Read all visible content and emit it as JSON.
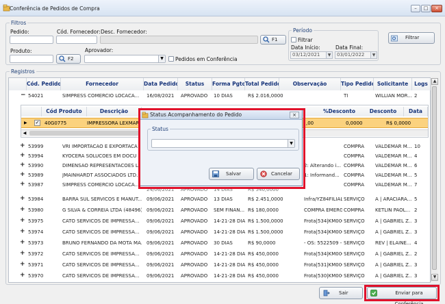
{
  "window": {
    "title": "Conferência de Pedidos de Compra",
    "min_glyph": "–",
    "max_glyph": "□",
    "close_glyph": "×"
  },
  "filtros": {
    "legend": "Filtros",
    "pedido_label": "Pedido:",
    "fornecedor_cod_label": "Cód. Fornecedor:",
    "fornecedor_desc_label": "Desc. Fornecedor:",
    "f1_label": "F1",
    "produto_label": "Produto:",
    "f2_label": "F2",
    "aprovador_label": "Aprovador:",
    "conferencia_label": "Pedidos em Conferência",
    "periodo_legend": "Período",
    "filtrar_check_label": "Filtrar",
    "data_inicio_label": "Data Início:",
    "data_final_label": "Data Final:",
    "data_inicio": "03/12/2021",
    "data_final": "03/01/2022",
    "filtrar_button": "Filtrar"
  },
  "registros": {
    "legend": "Registros",
    "columns": [
      "Cód. Pedido",
      "Fornecedor",
      "Data Pedido",
      "Status",
      "Forma Pgto",
      "Total Pedido",
      "Observação",
      "Tipo Pedido",
      "Solicitante",
      "Logs"
    ],
    "expanded_row": {
      "toggle": "−",
      "codigo": "54021",
      "fornecedor": "SIMPRESS COMERCIO LOCACA...",
      "data": "16/08/2021",
      "status": "APROVADO",
      "forma": "10 DIAS",
      "total": "R$ 2.016,0000",
      "obs": "",
      "tipo": "TI",
      "solicitante": "WILLIAN  MOR...",
      "logs": "2"
    },
    "sub_columns": [
      "Cód Produto",
      "Descrição",
      "%Desconto",
      "Desconto",
      "Data"
    ],
    "sub_row": {
      "codigo": "40G0775",
      "descricao": "IMPRESSORA LEXMAR",
      "valor": ",00",
      "pct": "0,0000",
      "desconto": "R$ 0,0000"
    },
    "rows": [
      {
        "codigo": "53999",
        "fornecedor": "VRI IMPORTACAO E EXPORTACA",
        "data": "",
        "status": "",
        "forma": "",
        "total": "",
        "obs": "",
        "tipo": "COMPRA",
        "solicitante": "VALDEMAR  M...",
        "logs": "10"
      },
      {
        "codigo": "53994",
        "fornecedor": "KYOCERA SOLUCOES EM DOCU",
        "data": "",
        "status": "",
        "forma": "",
        "total": "",
        "obs": "",
        "tipo": "COMPRA",
        "solicitante": "VALDEMAR  M...",
        "logs": "4"
      },
      {
        "codigo": "53990",
        "fornecedor": "DIMENSAO REPRESENTACOES L",
        "data": "",
        "status": "",
        "forma": "",
        "total": "",
        "obs": "2: Alterando i...",
        "tipo": "COMPRA",
        "solicitante": "VALDEMAR  M...",
        "logs": "6"
      },
      {
        "codigo": "53989",
        "fornecedor": "JMAINHARDT ASSOCIADOS LTD.",
        "data": "",
        "status": "",
        "forma": "",
        "total": "",
        "obs": "1: Informand...",
        "tipo": "COMPRA",
        "solicitante": "VALDEMAR  M...",
        "logs": "5"
      },
      {
        "codigo": "53987",
        "fornecedor": "SIMPRESS COMERCIO LOCACA...",
        "data": "",
        "status": "",
        "forma": "",
        "total": "",
        "obs": "",
        "tipo": "COMPRA",
        "solicitante": "VALDEMAR  M...",
        "logs": "7"
      },
      {
        "codigo": "53984",
        "fornecedor": "BARRA SUL SERVICOS E MANUT...",
        "data": "09/06/2021",
        "status": "APROVADO",
        "forma": "13 DIAS",
        "total": "R$ 2.451,0000",
        "obs": "Infra/YZ84FILIAL|MANUTE...",
        "tipo": "SERVIÇO",
        "solicitante": "A | ARACIARA...",
        "logs": "5"
      },
      {
        "codigo": "53980",
        "fornecedor": "G SILVA & CORREIA LTDA (48496)",
        "data": "09/06/2021",
        "status": "APROVADO",
        "forma": "SEM FINAN...",
        "total": "R$ 180,0000",
        "obs": "COMPRA EMERGENCIAL",
        "tipo": "COMPRA",
        "solicitante": "KETLIN  PAOL...",
        "logs": "2"
      },
      {
        "codigo": "53975",
        "fornecedor": "CATO SERVICOS DE IMPRESSA...",
        "data": "09/06/2021",
        "status": "APROVADO",
        "forma": "14-21-28 DIA...",
        "total": "R$ 1.500,0000",
        "obs": "Frota|534|KM0000|  PLOTA...",
        "tipo": "SERVIÇO",
        "solicitante": "A | GABRIEL Z...",
        "logs": "3"
      },
      {
        "codigo": "53974",
        "fornecedor": "CATO SERVICOS DE IMPRESSA...",
        "data": "09/06/2021",
        "status": "APROVADO",
        "forma": "14-21-28 DIA...",
        "total": "R$ 1.500,0000",
        "obs": "Frota|534|KM0000|  PLOTA...",
        "tipo": "SERVIÇO",
        "solicitante": "A | GABRIEL Z...",
        "logs": "3"
      },
      {
        "codigo": "53973",
        "fornecedor": "BRUNO FERNANDO DA MOTA MA...",
        "data": "09/06/2021",
        "status": "APROVADO",
        "forma": "30 DIAS",
        "total": "R$ 90,0000",
        "obs": "- OS: 5522509 - SELB: 26...",
        "tipo": "SERVIÇO",
        "solicitante": "REV | ELAINE...",
        "logs": "4"
      },
      {
        "codigo": "53972",
        "fornecedor": "CATO SERVICOS DE IMPRESSA...",
        "data": "09/06/2021",
        "status": "APROVADO",
        "forma": "14-21-28 DIA...",
        "total": "R$ 450,0000",
        "obs": "Frota|534|KM0000|  PLOTA...",
        "tipo": "SERVIÇO",
        "solicitante": "A | GABRIEL Z...",
        "logs": "2"
      },
      {
        "codigo": "53971",
        "fornecedor": "CATO SERVICOS DE IMPRESSA...",
        "data": "09/06/2021",
        "status": "APROVADO",
        "forma": "14-21-28 DIA...",
        "total": "R$ 450,0000",
        "obs": "Frota|531|KM0000|  PLOTA...",
        "tipo": "SERVIÇO",
        "solicitante": "A | GABRIEL Z...",
        "logs": "3"
      },
      {
        "codigo": "53970",
        "fornecedor": "CATO SERVICOS DE IMPRESSA...",
        "data": "09/06/2021",
        "status": "APROVADO",
        "forma": "14-21-28 DIA...",
        "total": "R$ 450,0000",
        "obs": "Frota|530|KM0000|  PLOTA...",
        "tipo": "SERVIÇO",
        "solicitante": "A | GABRIEL Z...",
        "logs": "3"
      }
    ],
    "partial_row": {
      "data": "24/06/2021",
      "status": "APROVADO",
      "forma": "14 DIAS",
      "total": "R$ 540,0000"
    }
  },
  "dialog": {
    "title": "Status Acompanhamento do Pedido",
    "close_glyph": "×",
    "status_legend": "Status",
    "salvar_label": "Salvar",
    "cancelar_label": "Cancelar"
  },
  "footer": {
    "sair_label": "Sair",
    "enviar_label": "Enviar para Conferência"
  },
  "colors": {
    "accent_red": "#e0112b",
    "highlight_orange": "#fbd27e",
    "selection_blue": "#c5d8f2"
  }
}
